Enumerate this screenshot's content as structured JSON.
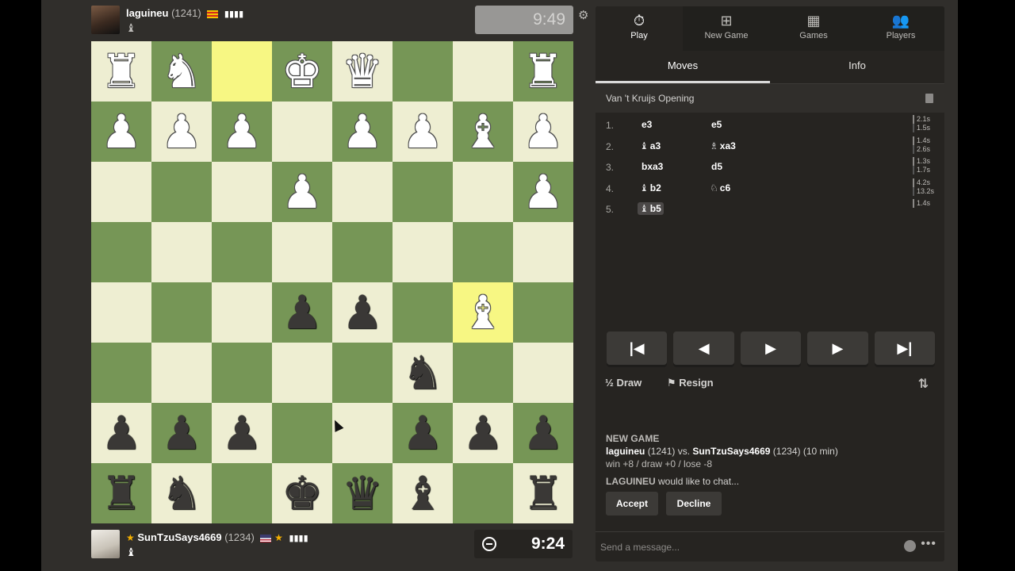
{
  "top_player": {
    "name": "laguineu",
    "rating": "(1241)",
    "bars": "▮▮▮▮",
    "captured": "♝",
    "clock": "9:49"
  },
  "bottom_player": {
    "name": "SunTzuSays4669",
    "rating": "(1234)",
    "bars": "▮▮▮▮",
    "captured": "♝",
    "clock": "9:24"
  },
  "icons": {
    "settings": "⚙",
    "star": "★"
  },
  "board": {
    "rows": [
      [
        {
          "p": "♜",
          "c": "w"
        },
        {
          "p": "♞",
          "c": "w"
        },
        {
          "p": "",
          "c": "",
          "hl": true
        },
        {
          "p": "♚",
          "c": "w"
        },
        {
          "p": "♛",
          "c": "w"
        },
        {
          "p": "",
          "c": ""
        },
        {
          "p": "",
          "c": ""
        },
        {
          "p": "♜",
          "c": "w"
        }
      ],
      [
        {
          "p": "♟",
          "c": "w"
        },
        {
          "p": "♟",
          "c": "w"
        },
        {
          "p": "♟",
          "c": "w"
        },
        {
          "p": "",
          "c": ""
        },
        {
          "p": "♟",
          "c": "w"
        },
        {
          "p": "♟",
          "c": "w"
        },
        {
          "p": "♝",
          "c": "w"
        },
        {
          "p": "♟",
          "c": "w"
        }
      ],
      [
        {
          "p": "",
          "c": ""
        },
        {
          "p": "",
          "c": ""
        },
        {
          "p": "",
          "c": ""
        },
        {
          "p": "♟",
          "c": "w"
        },
        {
          "p": "",
          "c": ""
        },
        {
          "p": "",
          "c": ""
        },
        {
          "p": "",
          "c": ""
        },
        {
          "p": "♟",
          "c": "w"
        }
      ],
      [
        {
          "p": "",
          "c": ""
        },
        {
          "p": "",
          "c": ""
        },
        {
          "p": "",
          "c": ""
        },
        {
          "p": "",
          "c": ""
        },
        {
          "p": "",
          "c": ""
        },
        {
          "p": "",
          "c": ""
        },
        {
          "p": "",
          "c": ""
        },
        {
          "p": "",
          "c": ""
        }
      ],
      [
        {
          "p": "",
          "c": ""
        },
        {
          "p": "",
          "c": ""
        },
        {
          "p": "",
          "c": ""
        },
        {
          "p": "♟",
          "c": "b"
        },
        {
          "p": "♟",
          "c": "b"
        },
        {
          "p": "",
          "c": ""
        },
        {
          "p": "♝",
          "c": "w",
          "hl": true
        },
        {
          "p": "",
          "c": ""
        }
      ],
      [
        {
          "p": "",
          "c": ""
        },
        {
          "p": "",
          "c": ""
        },
        {
          "p": "",
          "c": ""
        },
        {
          "p": "",
          "c": ""
        },
        {
          "p": "",
          "c": ""
        },
        {
          "p": "♞",
          "c": "b"
        },
        {
          "p": "",
          "c": ""
        },
        {
          "p": "",
          "c": ""
        }
      ],
      [
        {
          "p": "♟",
          "c": "b"
        },
        {
          "p": "♟",
          "c": "b"
        },
        {
          "p": "♟",
          "c": "b"
        },
        {
          "p": "",
          "c": ""
        },
        {
          "p": "",
          "c": ""
        },
        {
          "p": "♟",
          "c": "b"
        },
        {
          "p": "♟",
          "c": "b"
        },
        {
          "p": "♟",
          "c": "b"
        }
      ],
      [
        {
          "p": "♜",
          "c": "b"
        },
        {
          "p": "♞",
          "c": "b"
        },
        {
          "p": "",
          "c": ""
        },
        {
          "p": "♚",
          "c": "b"
        },
        {
          "p": "♛",
          "c": "b"
        },
        {
          "p": "♝",
          "c": "b"
        },
        {
          "p": "",
          "c": ""
        },
        {
          "p": "♜",
          "c": "b"
        }
      ]
    ]
  },
  "nav": {
    "items": [
      {
        "label": "Play",
        "icon": "⏱",
        "active": true
      },
      {
        "label": "New Game",
        "icon": "⊞",
        "active": false
      },
      {
        "label": "Games",
        "icon": "▦",
        "active": false
      },
      {
        "label": "Players",
        "icon": "👥",
        "active": false
      }
    ]
  },
  "tabs": {
    "moves": "Moves",
    "info": "Info"
  },
  "opening": "Van 't Kruijs Opening",
  "moves": [
    {
      "num": "1.",
      "w_fig": "",
      "w": "e3",
      "b_fig": "",
      "b": "e5",
      "times": [
        "2.1s",
        "1.5s"
      ]
    },
    {
      "num": "2.",
      "w_fig": "♝",
      "w": "a3",
      "b_fig": "♗",
      "b": "xa3",
      "times": [
        "1.4s",
        "2.6s"
      ]
    },
    {
      "num": "3.",
      "w_fig": "",
      "w": "bxa3",
      "b_fig": "",
      "b": "d5",
      "times": [
        "1.3s",
        "1.7s"
      ]
    },
    {
      "num": "4.",
      "w_fig": "♝",
      "w": "b2",
      "b_fig": "♘",
      "b": "c6",
      "times": [
        "4.2s",
        "13.2s"
      ]
    },
    {
      "num": "5.",
      "w_fig": "♝",
      "w": "b5",
      "b_fig": "",
      "b": "",
      "times": [
        "1.4s"
      ]
    }
  ],
  "controls": {
    "first": "|◀",
    "prev": "◀",
    "play": "▶",
    "next": "▶",
    "last": "▶|"
  },
  "actions": {
    "draw": "½ Draw",
    "resign": "⚑ Resign",
    "flip": "⇅"
  },
  "chat": {
    "title": "NEW GAME",
    "white_name": "laguineu",
    "white_rating": "(1241)",
    "vs": "vs.",
    "black_name": "SunTzuSays4669",
    "black_rating": "(1234)",
    "time_control": "(10 min)",
    "score": "win +8 / draw +0 / lose -8",
    "request_user": "LAGUINEU",
    "request_text": "would like to chat...",
    "accept": "Accept",
    "decline": "Decline",
    "placeholder": "Send a message...",
    "more": "•••"
  }
}
